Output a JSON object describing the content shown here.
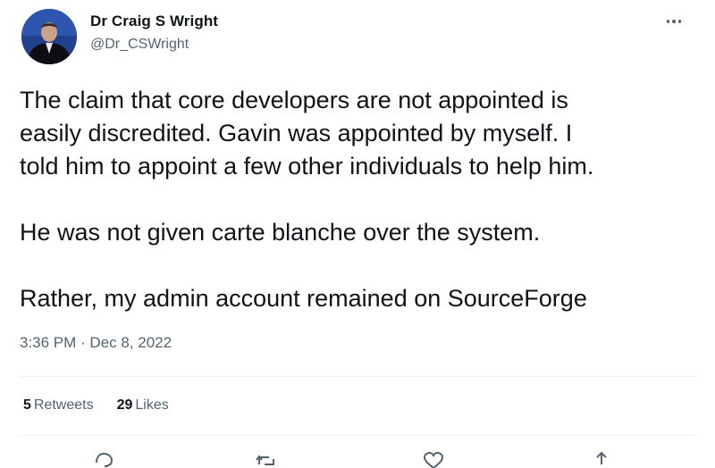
{
  "author": {
    "display_name": "Dr Craig S Wright",
    "handle": "@Dr_CSWright"
  },
  "tweet": {
    "paragraphs": [
      "The claim that core developers are not appointed is\neasily discredited. Gavin was appointed by myself. I\ntold him to appoint a few other individuals to help him.",
      "He was not given carte blanche over the system.",
      "Rather, my admin account remained on SourceForge"
    ],
    "timestamp": "3:36 PM · Dec 8, 2022"
  },
  "stats": {
    "retweets_count": "5",
    "retweets_label": "Retweets",
    "likes_count": "29",
    "likes_label": "Likes"
  },
  "icons": {
    "more": "more-dots-icon",
    "reply": "reply-icon",
    "retweet": "retweet-icon",
    "like": "heart-icon",
    "share": "share-icon"
  },
  "colors": {
    "text": "#0f1419",
    "secondary": "#536471",
    "divider": "#eff3f4"
  }
}
